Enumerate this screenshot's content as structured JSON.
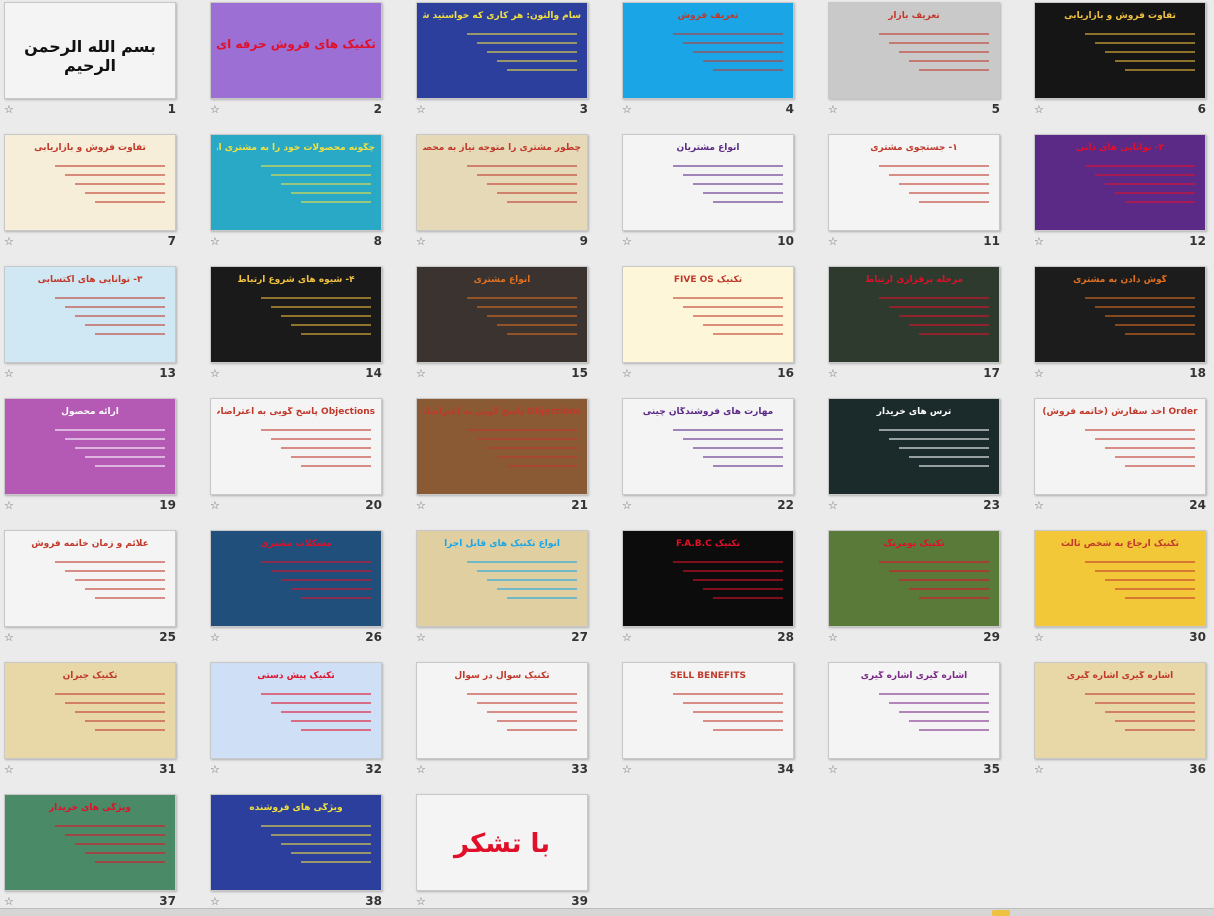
{
  "slides": [
    {
      "number": "1",
      "title": "بسم الله الرحمن الرحیم",
      "bg": "#f4f4f4",
      "fg": "#111111"
    },
    {
      "number": "2",
      "title": "تکنیک های فروش حرفه ای",
      "bg": "#9b6fd4",
      "fg": "#e0102a"
    },
    {
      "number": "3",
      "title": "سام والتون: هر کاری که خواستید شروع کنید",
      "bg": "#2d3f9c",
      "fg": "#f0e040"
    },
    {
      "number": "4",
      "title": "تعریف فروش",
      "bg": "#1aa5e6",
      "fg": "#c0392b"
    },
    {
      "number": "5",
      "title": "تعریف بازار",
      "bg": "#c9c9c9",
      "fg": "#c0392b"
    },
    {
      "number": "6",
      "title": "تفاوت فروش و بازاریابی",
      "bg": "#151515",
      "fg": "#f0c040"
    },
    {
      "number": "7",
      "title": "تفاوت فروش و بازاریابی",
      "bg": "#f6eed8",
      "fg": "#c0392b"
    },
    {
      "number": "8",
      "title": "چگونه محصولات خود را به مشتری ارائه دهیم",
      "bg": "#2aa9c6",
      "fg": "#f0e040"
    },
    {
      "number": "9",
      "title": "چطور مشتری را متوجه نیاز به محصولات کنیم",
      "bg": "#e6d9b8",
      "fg": "#c0392b"
    },
    {
      "number": "10",
      "title": "انواع مشتریان",
      "bg": "#f4f4f4",
      "fg": "#5b2a86"
    },
    {
      "number": "11",
      "title": "۱- جستجوی مشتری",
      "bg": "#f4f4f4",
      "fg": "#c0392b"
    },
    {
      "number": "12",
      "title": "۲- توانایی های ذاتی",
      "bg": "#5b2a86",
      "fg": "#e0102a"
    },
    {
      "number": "13",
      "title": "۳- توانایی های اکتسابی",
      "bg": "#cfe8f3",
      "fg": "#c0392b"
    },
    {
      "number": "14",
      "title": "۴- شیوه های شروع ارتباط",
      "bg": "#1a1a1a",
      "fg": "#f0c040"
    },
    {
      "number": "15",
      "title": "انواع مشتری",
      "bg": "#3a3330",
      "fg": "#e07020"
    },
    {
      "number": "16",
      "title": "تکنیک FIVE OS",
      "bg": "#fdf6d9",
      "fg": "#c0392b"
    },
    {
      "number": "17",
      "title": "مرحله برقراری ارتباط",
      "bg": "#2d3a2d",
      "fg": "#e0102a"
    },
    {
      "number": "18",
      "title": "گوش دادن به مشتری",
      "bg": "#1c1c1c",
      "fg": "#e07020"
    },
    {
      "number": "19",
      "title": "ارائه محصول",
      "bg": "#b45ab4",
      "fg": "#ffffff"
    },
    {
      "number": "20",
      "title": "Objections پاسخ گویی به اعتراضات",
      "bg": "#f4f4f4",
      "fg": "#c0392b"
    },
    {
      "number": "21",
      "title": "Objections پاسخ گویی به اعتراضات",
      "bg": "#8a5a34",
      "fg": "#c0392b"
    },
    {
      "number": "22",
      "title": "مهارت های فروشندگان چینی",
      "bg": "#f4f4f4",
      "fg": "#5b2a86"
    },
    {
      "number": "23",
      "title": "ترس های خریدار",
      "bg": "#1b2a2a",
      "fg": "#ffffff"
    },
    {
      "number": "24",
      "title": "Order اخذ سفارش (خاتمه فروش)",
      "bg": "#f4f4f4",
      "fg": "#c0392b"
    },
    {
      "number": "25",
      "title": "علائم و زمان خاتمه فروش",
      "bg": "#f4f4f4",
      "fg": "#c0392b"
    },
    {
      "number": "26",
      "title": "مشکلات مشتری",
      "bg": "#1f4f7a",
      "fg": "#e0102a"
    },
    {
      "number": "27",
      "title": "انواع تکنیک های قابل اجرا",
      "bg": "#e0cfa0",
      "fg": "#1aa5e6"
    },
    {
      "number": "28",
      "title": "تکنیک F.A.B.C",
      "bg": "#0c0c0c",
      "fg": "#e0102a"
    },
    {
      "number": "29",
      "title": "تکنیک بومرنگ",
      "bg": "#5a7a3a",
      "fg": "#e0102a"
    },
    {
      "number": "30",
      "title": "تکنیک ارجاع به شخص ثالث",
      "bg": "#f2c738",
      "fg": "#c0392b"
    },
    {
      "number": "31",
      "title": "تکنیک جبران",
      "bg": "#e8d8a8",
      "fg": "#c0392b"
    },
    {
      "number": "32",
      "title": "تکنیک پیش دستی",
      "bg": "#cfe0f6",
      "fg": "#e0102a"
    },
    {
      "number": "33",
      "title": "تکنیک سوال در سوال",
      "bg": "#f4f4f4",
      "fg": "#c0392b"
    },
    {
      "number": "34",
      "title": "SELL BENEFITS",
      "bg": "#f4f4f4",
      "fg": "#c0392b"
    },
    {
      "number": "35",
      "title": "اشاره گیری اشاره گیری",
      "bg": "#f4f4f4",
      "fg": "#7a2a86"
    },
    {
      "number": "36",
      "title": "اشاره گیری اشاره گیری",
      "bg": "#e8d8a8",
      "fg": "#c0392b"
    },
    {
      "number": "37",
      "title": "ویژگی های خریدار",
      "bg": "#4a8a66",
      "fg": "#e0102a"
    },
    {
      "number": "38",
      "title": "ویژگی های فروشنده",
      "bg": "#2d3f9c",
      "fg": "#f0e040"
    },
    {
      "number": "39",
      "title": "با تشکر",
      "bg": "#f4f4f4",
      "fg": "#e0102a"
    }
  ]
}
